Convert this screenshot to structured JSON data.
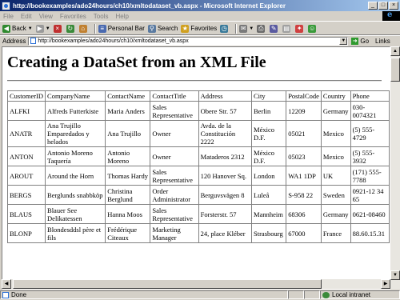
{
  "window": {
    "title": "http://bookexamples/ado24hours/ch10/xmltodataset_vb.aspx - Microsoft Internet Explorer"
  },
  "menu": [
    "File",
    "Edit",
    "View",
    "Favorites",
    "Tools",
    "Help"
  ],
  "toolbar": {
    "back": "Back",
    "personal_bar": "Personal Bar",
    "search": "Search",
    "favorites": "Favorites"
  },
  "address": {
    "label": "Address",
    "url": "http://bookexamples/ado24hours/ch10/xmltodataset_vb.aspx",
    "go": "Go",
    "links": "Links"
  },
  "page": {
    "heading": "Creating a DataSet from an XML File",
    "columns": [
      "CustomerID",
      "CompanyName",
      "ContactName",
      "ContactTitle",
      "Address",
      "City",
      "PostalCode",
      "Country",
      "Phone"
    ],
    "rows": [
      [
        "ALFKI",
        "Alfreds Futterkiste",
        "Maria Anders",
        "Sales Representative",
        "Obere Str. 57",
        "Berlin",
        "12209",
        "Germany",
        "030-0074321"
      ],
      [
        "ANATR",
        "Ana Trujillo Emparedados y helados",
        "Ana Trujillo",
        "Owner",
        "Avda. de la Constitución 2222",
        "México D.F.",
        "05021",
        "Mexico",
        "(5) 555-4729"
      ],
      [
        "ANTON",
        "Antonio Moreno Taquería",
        "Antonio Moreno",
        "Owner",
        "Mataderos 2312",
        "México D.F.",
        "05023",
        "Mexico",
        "(5) 555-3932"
      ],
      [
        "AROUT",
        "Around the Horn",
        "Thomas Hardy",
        "Sales Representative",
        "120 Hanover Sq.",
        "London",
        "WA1 1DP",
        "UK",
        "(171) 555-7788"
      ],
      [
        "BERGS",
        "Berglunds snabbköp",
        "Christina Berglund",
        "Order Administrator",
        "Berguvsvägen 8",
        "Luleå",
        "S-958 22",
        "Sweden",
        "0921-12 34 65"
      ],
      [
        "BLAUS",
        "Blauer See Delikatessen",
        "Hanna Moos",
        "Sales Representative",
        "Forsterstr. 57",
        "Mannheim",
        "68306",
        "Germany",
        "0621-08460"
      ],
      [
        "BLONP",
        "Blondesddsl père et fils",
        "Frédérique Citeaux",
        "Marketing Manager",
        "24, place Kléber",
        "Strasbourg",
        "67000",
        "France",
        "88.60.15.31"
      ]
    ]
  },
  "status": {
    "text": "Done",
    "zone": "Local intranet"
  }
}
